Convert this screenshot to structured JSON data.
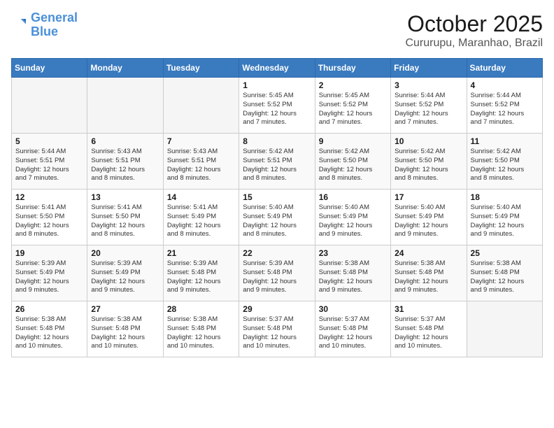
{
  "logo": {
    "general": "General",
    "blue": "Blue"
  },
  "title": "October 2025",
  "subtitle": "Cururupu, Maranhao, Brazil",
  "weekdays": [
    "Sunday",
    "Monday",
    "Tuesday",
    "Wednesday",
    "Thursday",
    "Friday",
    "Saturday"
  ],
  "weeks": [
    [
      {
        "day": "",
        "info": ""
      },
      {
        "day": "",
        "info": ""
      },
      {
        "day": "",
        "info": ""
      },
      {
        "day": "1",
        "info": "Sunrise: 5:45 AM\nSunset: 5:52 PM\nDaylight: 12 hours\nand 7 minutes."
      },
      {
        "day": "2",
        "info": "Sunrise: 5:45 AM\nSunset: 5:52 PM\nDaylight: 12 hours\nand 7 minutes."
      },
      {
        "day": "3",
        "info": "Sunrise: 5:44 AM\nSunset: 5:52 PM\nDaylight: 12 hours\nand 7 minutes."
      },
      {
        "day": "4",
        "info": "Sunrise: 5:44 AM\nSunset: 5:52 PM\nDaylight: 12 hours\nand 7 minutes."
      }
    ],
    [
      {
        "day": "5",
        "info": "Sunrise: 5:44 AM\nSunset: 5:51 PM\nDaylight: 12 hours\nand 7 minutes."
      },
      {
        "day": "6",
        "info": "Sunrise: 5:43 AM\nSunset: 5:51 PM\nDaylight: 12 hours\nand 8 minutes."
      },
      {
        "day": "7",
        "info": "Sunrise: 5:43 AM\nSunset: 5:51 PM\nDaylight: 12 hours\nand 8 minutes."
      },
      {
        "day": "8",
        "info": "Sunrise: 5:42 AM\nSunset: 5:51 PM\nDaylight: 12 hours\nand 8 minutes."
      },
      {
        "day": "9",
        "info": "Sunrise: 5:42 AM\nSunset: 5:50 PM\nDaylight: 12 hours\nand 8 minutes."
      },
      {
        "day": "10",
        "info": "Sunrise: 5:42 AM\nSunset: 5:50 PM\nDaylight: 12 hours\nand 8 minutes."
      },
      {
        "day": "11",
        "info": "Sunrise: 5:42 AM\nSunset: 5:50 PM\nDaylight: 12 hours\nand 8 minutes."
      }
    ],
    [
      {
        "day": "12",
        "info": "Sunrise: 5:41 AM\nSunset: 5:50 PM\nDaylight: 12 hours\nand 8 minutes."
      },
      {
        "day": "13",
        "info": "Sunrise: 5:41 AM\nSunset: 5:50 PM\nDaylight: 12 hours\nand 8 minutes."
      },
      {
        "day": "14",
        "info": "Sunrise: 5:41 AM\nSunset: 5:49 PM\nDaylight: 12 hours\nand 8 minutes."
      },
      {
        "day": "15",
        "info": "Sunrise: 5:40 AM\nSunset: 5:49 PM\nDaylight: 12 hours\nand 8 minutes."
      },
      {
        "day": "16",
        "info": "Sunrise: 5:40 AM\nSunset: 5:49 PM\nDaylight: 12 hours\nand 9 minutes."
      },
      {
        "day": "17",
        "info": "Sunrise: 5:40 AM\nSunset: 5:49 PM\nDaylight: 12 hours\nand 9 minutes."
      },
      {
        "day": "18",
        "info": "Sunrise: 5:40 AM\nSunset: 5:49 PM\nDaylight: 12 hours\nand 9 minutes."
      }
    ],
    [
      {
        "day": "19",
        "info": "Sunrise: 5:39 AM\nSunset: 5:49 PM\nDaylight: 12 hours\nand 9 minutes."
      },
      {
        "day": "20",
        "info": "Sunrise: 5:39 AM\nSunset: 5:49 PM\nDaylight: 12 hours\nand 9 minutes."
      },
      {
        "day": "21",
        "info": "Sunrise: 5:39 AM\nSunset: 5:48 PM\nDaylight: 12 hours\nand 9 minutes."
      },
      {
        "day": "22",
        "info": "Sunrise: 5:39 AM\nSunset: 5:48 PM\nDaylight: 12 hours\nand 9 minutes."
      },
      {
        "day": "23",
        "info": "Sunrise: 5:38 AM\nSunset: 5:48 PM\nDaylight: 12 hours\nand 9 minutes."
      },
      {
        "day": "24",
        "info": "Sunrise: 5:38 AM\nSunset: 5:48 PM\nDaylight: 12 hours\nand 9 minutes."
      },
      {
        "day": "25",
        "info": "Sunrise: 5:38 AM\nSunset: 5:48 PM\nDaylight: 12 hours\nand 9 minutes."
      }
    ],
    [
      {
        "day": "26",
        "info": "Sunrise: 5:38 AM\nSunset: 5:48 PM\nDaylight: 12 hours\nand 10 minutes."
      },
      {
        "day": "27",
        "info": "Sunrise: 5:38 AM\nSunset: 5:48 PM\nDaylight: 12 hours\nand 10 minutes."
      },
      {
        "day": "28",
        "info": "Sunrise: 5:38 AM\nSunset: 5:48 PM\nDaylight: 12 hours\nand 10 minutes."
      },
      {
        "day": "29",
        "info": "Sunrise: 5:37 AM\nSunset: 5:48 PM\nDaylight: 12 hours\nand 10 minutes."
      },
      {
        "day": "30",
        "info": "Sunrise: 5:37 AM\nSunset: 5:48 PM\nDaylight: 12 hours\nand 10 minutes."
      },
      {
        "day": "31",
        "info": "Sunrise: 5:37 AM\nSunset: 5:48 PM\nDaylight: 12 hours\nand 10 minutes."
      },
      {
        "day": "",
        "info": ""
      }
    ]
  ]
}
